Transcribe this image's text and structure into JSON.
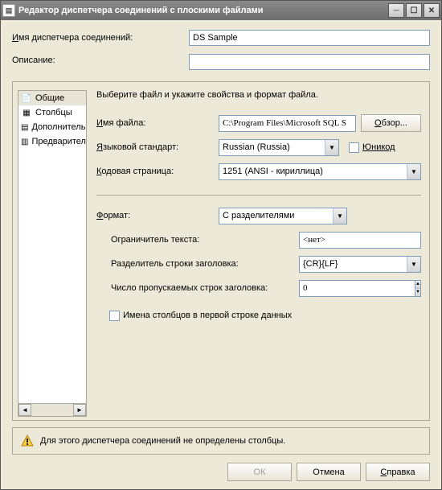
{
  "window": {
    "title": "Редактор диспетчера соединений с плоскими файлами"
  },
  "top": {
    "name_label": "Имя диспетчера соединений:",
    "name_value": "DS Sample",
    "desc_label": "Описание:",
    "desc_value": ""
  },
  "side": {
    "items": [
      {
        "label": "Общие"
      },
      {
        "label": "Столбцы"
      },
      {
        "label": "Дополнительно"
      },
      {
        "label": "Предварительный просмотр"
      }
    ]
  },
  "instr": "Выберите файл и укажите свойства и формат файла.",
  "form": {
    "file_label": "Имя файла:",
    "file_value": "C:\\Program Files\\Microsoft SQL S",
    "browse": "Обзор...",
    "locale_label": "Языковой стандарт:",
    "locale_value": "Russian (Russia)",
    "unicode_label": "Юникод",
    "codepage_label": "Кодовая страница:",
    "codepage_value": "1251  (ANSI - кириллица)",
    "format_label": "Формат:",
    "format_value": "С разделителями",
    "textq_label": "Ограничитель текста:",
    "textq_value": "<нет>",
    "hdrdelim_label": "Разделитель строки заголовка:",
    "hdrdelim_value": "{CR}{LF}",
    "skip_label": "Число пропускаемых строк заголовка:",
    "skip_value": "0",
    "firstrow_label": "Имена столбцов в первой строке данных"
  },
  "warning": "Для этого диспетчера соединений не определены столбцы.",
  "buttons": {
    "ok": "ОК",
    "cancel": "Отмена",
    "help": "Справка"
  }
}
